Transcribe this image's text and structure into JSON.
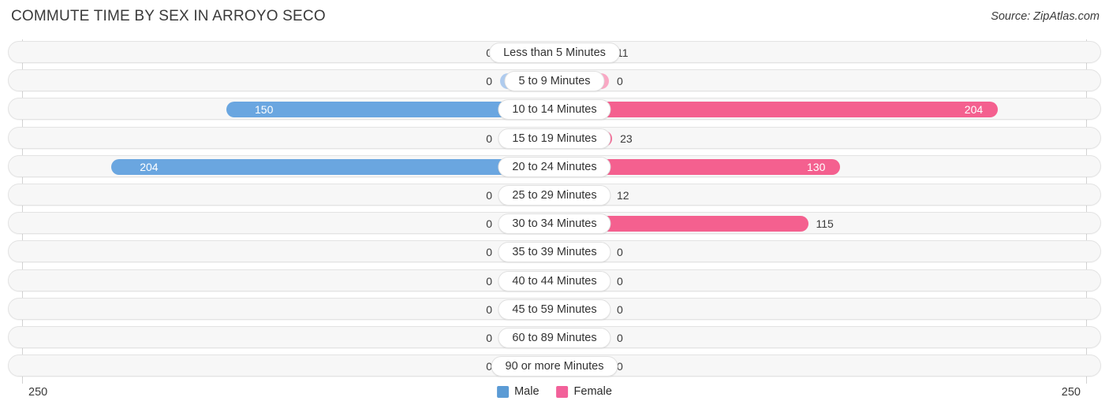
{
  "header": {
    "title": "COMMUTE TIME BY SEX IN ARROYO SECO",
    "source": "Source: ZipAtlas.com"
  },
  "footer": {
    "axis_left": "250",
    "axis_right": "250"
  },
  "legend": {
    "items": [
      {
        "label": "Male",
        "color": "#5b9bd5"
      },
      {
        "label": "Female",
        "color": "#f2619a"
      }
    ]
  },
  "colors": {
    "male_strong": "#6aa6e0",
    "male_light": "#aecbee",
    "female_strong": "#f4608f",
    "female_light": "#f9a8c4",
    "row_bg": "#f7f7f7",
    "row_border": "#e3e3e3",
    "text": "#3a3a3a"
  },
  "chart_data": {
    "type": "bar",
    "subtype": "diverging-horizontal-bar",
    "title": "COMMUTE TIME BY SEX IN ARROYO SECO",
    "xlabel": "",
    "ylabel": "",
    "axis_max": 250,
    "axis_left_tick": "250",
    "axis_right_tick": "250",
    "grid": false,
    "legend_position": "bottom-center",
    "categories": [
      "Less than 5 Minutes",
      "5 to 9 Minutes",
      "10 to 14 Minutes",
      "15 to 19 Minutes",
      "20 to 24 Minutes",
      "25 to 29 Minutes",
      "30 to 34 Minutes",
      "35 to 39 Minutes",
      "40 to 44 Minutes",
      "45 to 59 Minutes",
      "60 to 89 Minutes",
      "90 or more Minutes"
    ],
    "series": [
      {
        "name": "Male",
        "side": "left",
        "color": "#5b9bd5",
        "values": [
          0,
          0,
          150,
          0,
          204,
          0,
          0,
          0,
          0,
          0,
          0,
          0
        ]
      },
      {
        "name": "Female",
        "side": "right",
        "color": "#f2619a",
        "values": [
          11,
          0,
          204,
          23,
          130,
          12,
          115,
          0,
          0,
          0,
          0,
          0
        ]
      }
    ],
    "rows": [
      {
        "category": "Less than 5 Minutes",
        "male": 0,
        "male_text": "0",
        "female": 11,
        "female_text": "11"
      },
      {
        "category": "5 to 9 Minutes",
        "male": 0,
        "male_text": "0",
        "female": 0,
        "female_text": "0"
      },
      {
        "category": "10 to 14 Minutes",
        "male": 150,
        "male_text": "150",
        "female": 204,
        "female_text": "204"
      },
      {
        "category": "15 to 19 Minutes",
        "male": 0,
        "male_text": "0",
        "female": 23,
        "female_text": "23"
      },
      {
        "category": "20 to 24 Minutes",
        "male": 204,
        "male_text": "204",
        "female": 130,
        "female_text": "130"
      },
      {
        "category": "25 to 29 Minutes",
        "male": 0,
        "male_text": "0",
        "female": 12,
        "female_text": "12"
      },
      {
        "category": "30 to 34 Minutes",
        "male": 0,
        "male_text": "0",
        "female": 115,
        "female_text": "115"
      },
      {
        "category": "35 to 39 Minutes",
        "male": 0,
        "male_text": "0",
        "female": 0,
        "female_text": "0"
      },
      {
        "category": "40 to 44 Minutes",
        "male": 0,
        "male_text": "0",
        "female": 0,
        "female_text": "0"
      },
      {
        "category": "45 to 59 Minutes",
        "male": 0,
        "male_text": "0",
        "female": 0,
        "female_text": "0"
      },
      {
        "category": "60 to 89 Minutes",
        "male": 0,
        "male_text": "0",
        "female": 0,
        "female_text": "0"
      },
      {
        "category": "90 or more Minutes",
        "male": 0,
        "male_text": "0",
        "female": 0,
        "female_text": "0"
      }
    ]
  }
}
